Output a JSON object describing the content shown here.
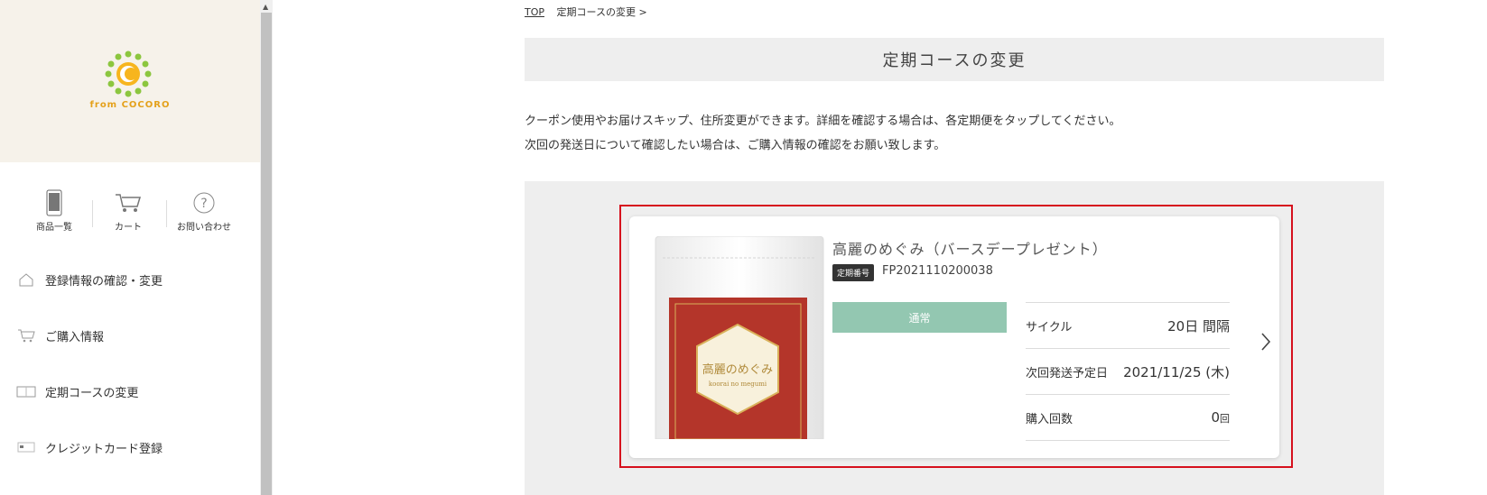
{
  "logo": {
    "text": "from COCORO"
  },
  "quick_nav": [
    {
      "label": "商品一覧",
      "icon": "phone-icon"
    },
    {
      "label": "カート",
      "icon": "cart-icon"
    },
    {
      "label": "お問い合わせ",
      "icon": "question-icon"
    }
  ],
  "menu": [
    {
      "label": "登録情報の確認・変更",
      "icon": "house-icon"
    },
    {
      "label": "ご購入情報",
      "icon": "cart-icon"
    },
    {
      "label": "定期コースの変更",
      "icon": "calendar-icon"
    },
    {
      "label": "クレジットカード登録",
      "icon": "card-icon"
    }
  ],
  "breadcrumb": {
    "top": "TOP",
    "current": "定期コースの変更 >"
  },
  "page_title": "定期コースの変更",
  "description": [
    "クーポン使用やお届けスキップ、住所変更ができます。詳細を確認する場合は、各定期便をタップしてください。",
    "次回の発送日について確認したい場合は、ご購入情報の確認をお願い致します。"
  ],
  "course": {
    "product_name": "高麗のめぐみ（バースデープレゼント）",
    "order_label": "定期番号",
    "order_number": "FP2021110200038",
    "status": "通常",
    "package_text": "高麗のめぐみ",
    "package_subtext": "koorai no megumi",
    "rows": [
      {
        "label": "サイクル",
        "value": "20日 間隔",
        "unit": ""
      },
      {
        "label": "次回発送予定日",
        "value": "2021/11/25 (木)",
        "unit": ""
      },
      {
        "label": "購入回数",
        "value": "0",
        "unit": "回"
      }
    ]
  },
  "colors": {
    "accent_red": "#d6101d",
    "status_green": "#93c7b1",
    "logo_yellow": "#e4a11b",
    "logo_green": "#8cc63f"
  }
}
